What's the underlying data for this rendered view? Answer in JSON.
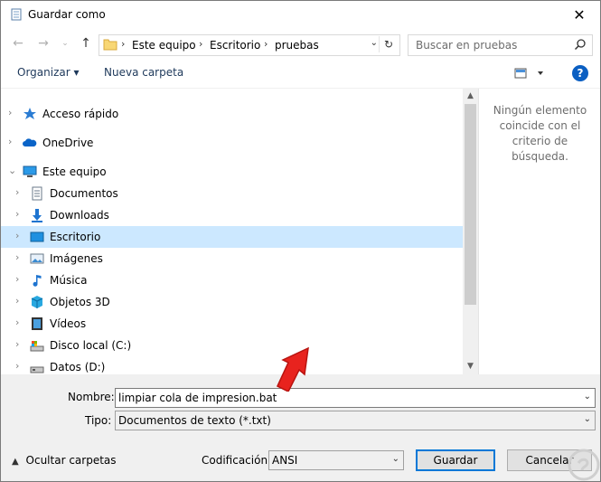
{
  "window": {
    "title": "Guardar como",
    "close_glyph": "✕"
  },
  "address": {
    "crumbs": [
      "Este equipo",
      "Escritorio",
      "pruebas"
    ],
    "search_placeholder": "Buscar en pruebas"
  },
  "toolbar": {
    "organize": "Organizar ▾",
    "new_folder": "Nueva carpeta"
  },
  "tree": [
    {
      "label": "Acceso rápido",
      "icon": "star-icon",
      "level": 0
    },
    {
      "label": "OneDrive",
      "icon": "cloud-icon",
      "level": 0
    },
    {
      "label": "Este equipo",
      "icon": "computer-icon",
      "level": 0,
      "expanded": true
    },
    {
      "label": "Documentos",
      "icon": "documents-icon",
      "level": 1
    },
    {
      "label": "Downloads",
      "icon": "download-icon",
      "level": 1
    },
    {
      "label": "Escritorio",
      "icon": "desktop-icon",
      "level": 1,
      "selected": true
    },
    {
      "label": "Imágenes",
      "icon": "pictures-icon",
      "level": 1
    },
    {
      "label": "Música",
      "icon": "music-icon",
      "level": 1
    },
    {
      "label": "Objetos 3D",
      "icon": "cube-icon",
      "level": 1
    },
    {
      "label": "Vídeos",
      "icon": "videos-icon",
      "level": 1
    },
    {
      "label": "Disco local (C:)",
      "icon": "drive-c-icon",
      "level": 1
    },
    {
      "label": "Datos (D:)",
      "icon": "drive-d-icon",
      "level": 1
    }
  ],
  "preview": {
    "empty_text": "Ningún elemento coincide con el criterio de búsqueda."
  },
  "form": {
    "name_label": "Nombre:",
    "name_value": "limpiar cola de impresion.bat",
    "type_label": "Tipo:",
    "type_value": "Documentos de texto (*.txt)",
    "encoding_label": "Codificación:",
    "encoding_value": "ANSI"
  },
  "footer": {
    "hide_folders": "Ocultar carpetas",
    "save": "Guardar",
    "cancel": "Cancelar"
  },
  "colors": {
    "selection": "#cce8ff",
    "accent": "#0078d7",
    "annotation_arrow": "#e8231e"
  }
}
